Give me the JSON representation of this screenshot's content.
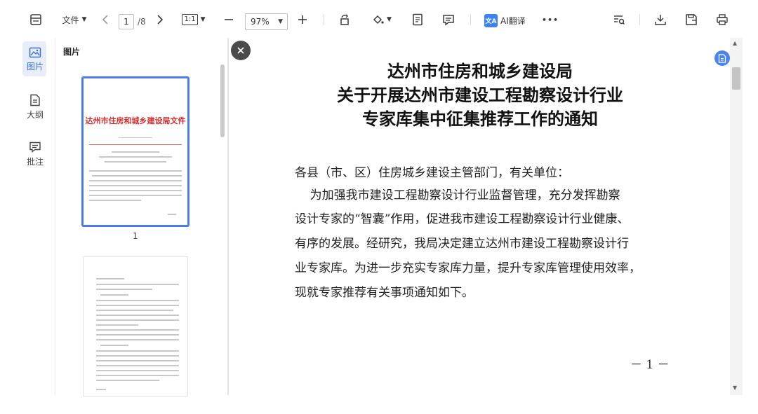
{
  "toolbar": {
    "file_menu": "文件",
    "current_page": "1",
    "total_pages": "/8",
    "fit_label": "1:1",
    "zoom": "97%",
    "ai_icon_text": "文A",
    "ai_translate": "AI翻译",
    "more": "•••"
  },
  "rail": {
    "items": [
      {
        "label": "图片",
        "icon": "image-icon"
      },
      {
        "label": "大纲",
        "icon": "outline-icon"
      },
      {
        "label": "批注",
        "icon": "comment-icon"
      }
    ]
  },
  "thumbnails": {
    "title": "图片",
    "page1_number": "1",
    "page1_heading": "达州市住房和城乡建设局文件"
  },
  "document": {
    "title_lines": [
      "达州市住房和城乡建设局",
      "关于开展达州市建设工程勘察设计行业",
      "专家库集中征集推荐工作的通知"
    ],
    "body_lines": [
      "各县（市、区）住房城乡建设主管部门，有关单位：",
      "    为加强我市建设工程勘察设计行业监督管理，充分发挥勘察",
      "设计专家的“智囊”作用，促进我市建设工程勘察设计行业健康、",
      "有序的发展。经研究，我局决定建立达州市建设工程勘察设计行",
      "业专家库。为进一步充实专家库力量，提升专家库管理使用效率，",
      "现就专家推荐有关事项通知如下。"
    ],
    "page_number": "－ 1 －"
  },
  "colors": {
    "accent": "#4a7de8",
    "doc_red": "#d42d2d"
  }
}
